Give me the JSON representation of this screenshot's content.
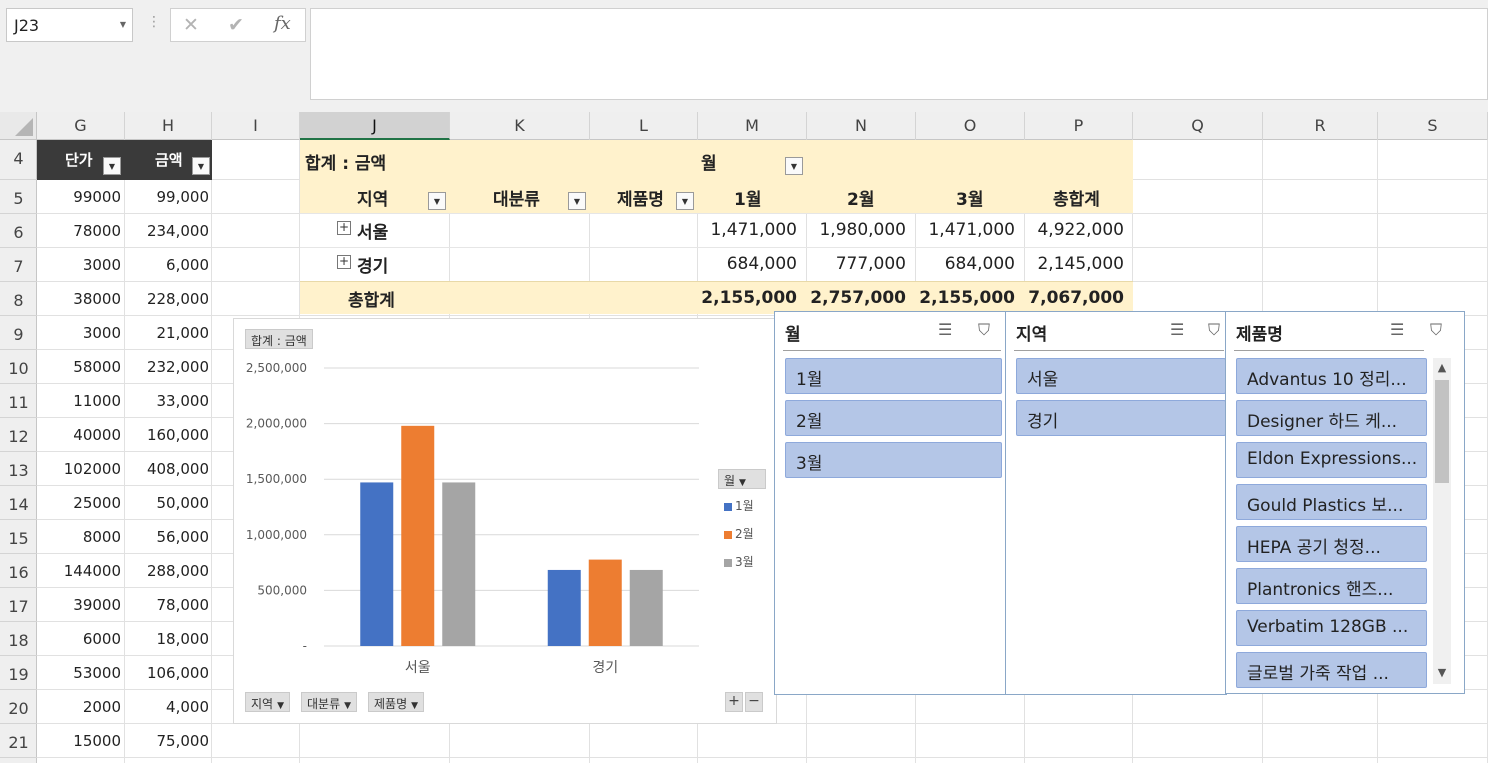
{
  "formula_bar": {
    "name_box": "J23",
    "cancel_icon": "✕",
    "enter_icon": "✔",
    "fx_label": "fx",
    "formula": ""
  },
  "columns": [
    "G",
    "H",
    "I",
    "J",
    "K",
    "L",
    "M",
    "N",
    "O",
    "P",
    "Q",
    "R",
    "S"
  ],
  "selected_column": "J",
  "rows": [
    "4",
    "5",
    "6",
    "7",
    "8",
    "9",
    "10",
    "11",
    "12",
    "13",
    "14",
    "15",
    "16",
    "17",
    "18",
    "19",
    "20",
    "21"
  ],
  "table": {
    "headers": {
      "unit_price": "단가",
      "amount": "금액"
    },
    "unit_prices": [
      "99000",
      "78000",
      "3000",
      "38000",
      "3000",
      "58000",
      "11000",
      "40000",
      "102000",
      "25000",
      "8000",
      "144000",
      "39000",
      "6000",
      "53000",
      "2000",
      "15000"
    ],
    "amounts": [
      "99,000",
      "234,000",
      "6,000",
      "228,000",
      "21,000",
      "232,000",
      "33,000",
      "160,000",
      "408,000",
      "50,000",
      "56,000",
      "288,000",
      "78,000",
      "18,000",
      "106,000",
      "4,000",
      "75,000"
    ]
  },
  "pivot": {
    "values_label": "합계 : 금액",
    "column_field": "월",
    "row_fields": [
      "지역",
      "대분류",
      "제품명"
    ],
    "month_headers": [
      "1월",
      "2월",
      "3월"
    ],
    "total_header": "총합계",
    "rows": [
      {
        "label": "서울",
        "values": [
          "1,471,000",
          "1,980,000",
          "1,471,000",
          "4,922,000"
        ]
      },
      {
        "label": "경기",
        "values": [
          "684,000",
          "777,000",
          "684,000",
          "2,145,000"
        ]
      }
    ],
    "grand_total": {
      "label": "총합계",
      "values": [
        "2,155,000",
        "2,757,000",
        "2,155,000",
        "7,067,000"
      ]
    }
  },
  "chart_data": {
    "type": "bar",
    "title": "합계 : 금액",
    "categories": [
      "서울",
      "경기"
    ],
    "series": [
      {
        "name": "1월",
        "values": [
          1471000,
          684000
        ],
        "color": "#4472c4"
      },
      {
        "name": "2월",
        "values": [
          1980000,
          777000
        ],
        "color": "#ed7d31"
      },
      {
        "name": "3월",
        "values": [
          1471000,
          684000
        ],
        "color": "#a5a5a5"
      }
    ],
    "ylim": [
      0,
      2500000
    ],
    "y_ticks": [
      0,
      500000,
      1000000,
      1500000,
      2000000,
      2500000
    ],
    "y_tick_labels": [
      "-",
      "500,000",
      "1,000,000",
      "1,500,000",
      "2,000,000",
      "2,500,000"
    ],
    "legend_field": "월",
    "legend_position": "right",
    "grid": true,
    "field_buttons": [
      "지역",
      "대분류",
      "제품명"
    ]
  },
  "slicers": {
    "month": {
      "title": "월",
      "items": [
        "1월",
        "2월",
        "3월"
      ]
    },
    "region": {
      "title": "지역",
      "items": [
        "서울",
        "경기"
      ]
    },
    "product": {
      "title": "제품명",
      "items": [
        "Advantus 10 정리...",
        "Designer 하드 케...",
        "Eldon Expressions...",
        "Gould Plastics 보...",
        "HEPA 공기 청정...",
        "Plantronics 핸즈...",
        "Verbatim 128GB ...",
        "글로벌 가죽 작업 ..."
      ]
    }
  },
  "colors": {
    "pivot_header_bg": "#fff2cc",
    "slicer_item_bg": "#b4c6e7",
    "table_header_bg": "#3a3a3a",
    "selected_col_accent": "#217346"
  }
}
